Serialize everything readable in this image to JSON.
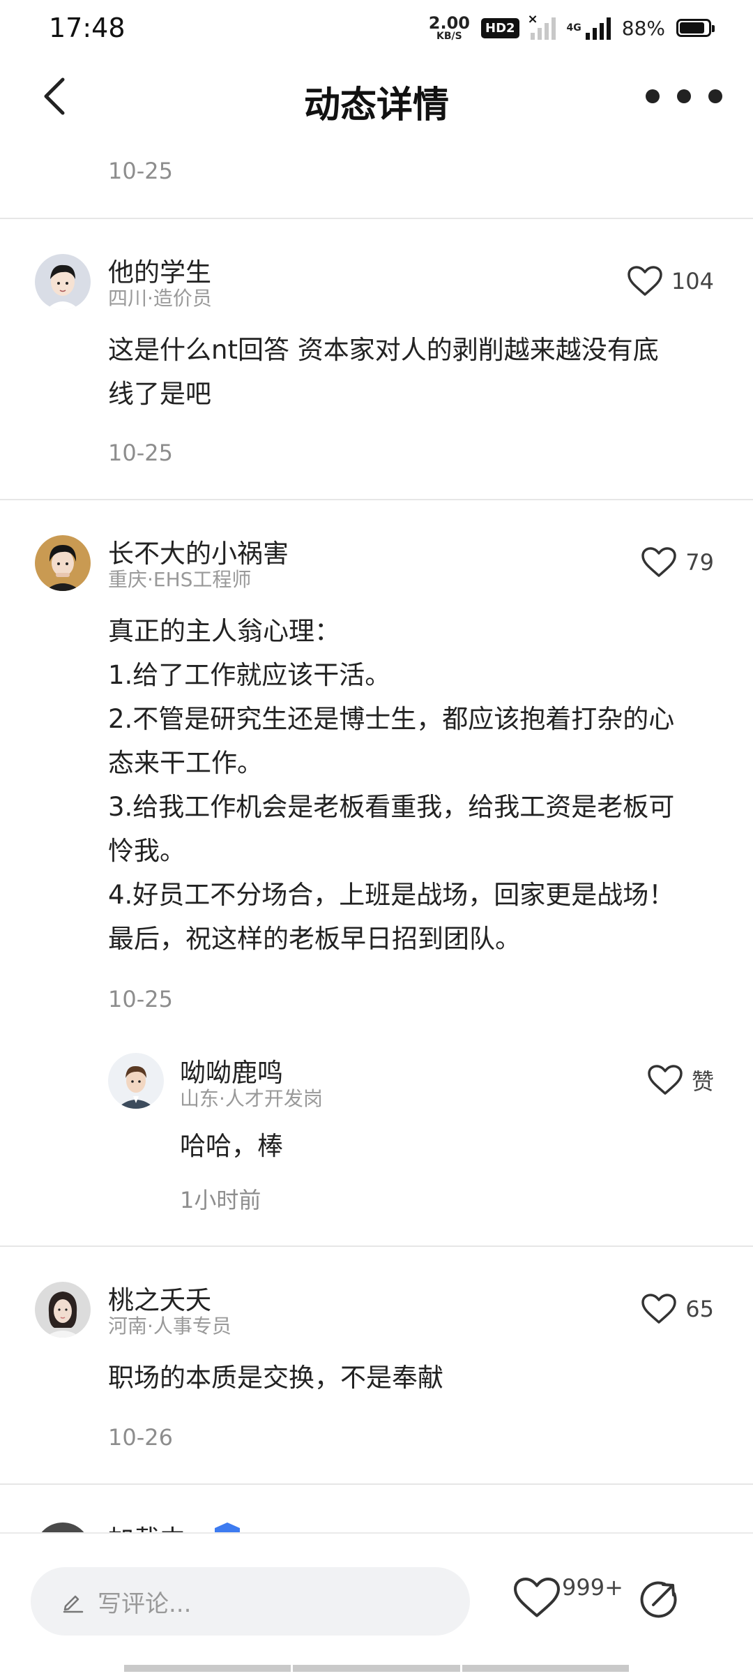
{
  "status_bar": {
    "time": "17:48",
    "net_speed_value": "2.00",
    "net_speed_unit": "KB/S",
    "hd_label": "HD2",
    "network_type": "4G",
    "battery_percent": "88%",
    "battery_level": 0.88
  },
  "nav": {
    "title": "动态详情"
  },
  "top_partial": {
    "date": "10-25"
  },
  "comments": [
    {
      "name": "他的学生",
      "location_role": "四川·造价员",
      "likes": "104",
      "text_lines": [
        "这是什么nt回答 资本家对人的剥削越来越没有底",
        "线了是吧"
      ],
      "date": "10-25"
    },
    {
      "name": "长不大的小祸害",
      "location_role": "重庆·EHS工程师",
      "likes": "79",
      "text_lines": [
        "真正的主人翁心理：",
        "1.给了工作就应该干活。",
        "2.不管是研究生还是博士生，都应该抱着打杂的心",
        "态来干工作。",
        "3.给我工作机会是老板看重我，给我工资是老板可",
        "怜我。",
        "4.好员工不分场合，上班是战场，回家更是战场！",
        "最后，祝这样的老板早日招到团队。"
      ],
      "date": "10-25",
      "reply": {
        "name": "呦呦鹿鸣",
        "location_role": "山东·人才开发岗",
        "likes": "赞",
        "text": "哈哈，棒",
        "time": "1小时前"
      }
    },
    {
      "name": "桃之夭夭",
      "location_role": "河南·人事专员",
      "likes": "65",
      "text_lines": [
        "职场的本质是交换，不是奉献"
      ],
      "date": "10-26"
    },
    {
      "name": "加载中"
    }
  ],
  "bottom_bar": {
    "comment_placeholder": "写评论...",
    "like_count": "999+"
  }
}
